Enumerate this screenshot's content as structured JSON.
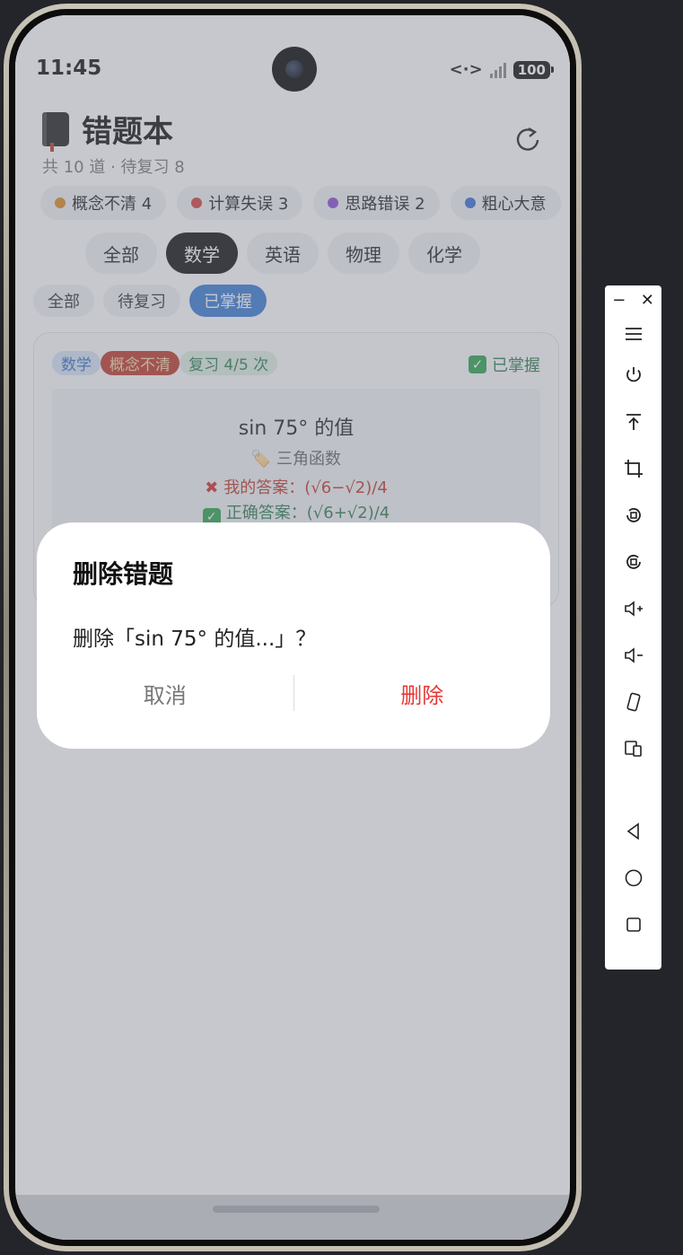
{
  "status": {
    "time": "11:45",
    "battery": "100"
  },
  "header": {
    "title": "错题本",
    "subtitle": "共 10 道 · 待复习 8"
  },
  "error_types": [
    {
      "label": "概念不清 4",
      "color": "#e08a1e"
    },
    {
      "label": "计算失误 3",
      "color": "#d94040"
    },
    {
      "label": "思路错误 2",
      "color": "#8a4fd6"
    },
    {
      "label": "粗心大意",
      "color": "#3a6fd6"
    }
  ],
  "subjects": [
    "全部",
    "数学",
    "英语",
    "物理",
    "化学"
  ],
  "active_subject": "数学",
  "filters": [
    "全部",
    "待复习",
    "已掌握"
  ],
  "active_filter": "已掌握",
  "card": {
    "tag_subject": "数学",
    "tag_type": "概念不清",
    "tag_review": "复习 4/5 次",
    "mastered_label": "已掌握",
    "question": "sin 75° 的值",
    "topic": "🏷️ 三角函数",
    "my_answer": "我的答案：(√6−√2)/4",
    "correct_answer": "正确答案：(√6+√2)/4"
  },
  "dialog": {
    "title": "删除错题",
    "message": "删除「sin 75° 的值...」？",
    "cancel": "取消",
    "confirm": "删除"
  }
}
